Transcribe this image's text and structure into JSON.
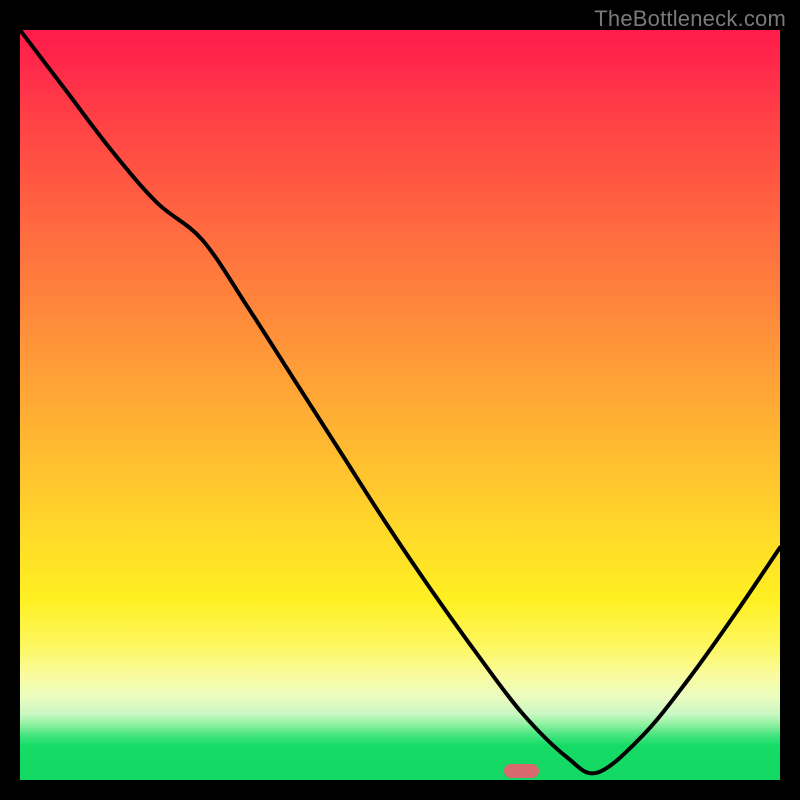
{
  "watermark": {
    "text": "TheBottleneck.com"
  },
  "chart_data": {
    "type": "line",
    "title": "",
    "xlabel": "",
    "ylabel": "",
    "x": [
      0,
      6,
      12,
      18,
      24,
      30,
      36,
      42,
      48,
      54,
      60,
      66,
      72,
      76,
      82,
      88,
      94,
      100
    ],
    "values": [
      100,
      92,
      84,
      77,
      72,
      63,
      53.5,
      44,
      34.5,
      25.5,
      17,
      9,
      3,
      1,
      6,
      13.5,
      22,
      31
    ],
    "xlim": [
      0,
      100
    ],
    "ylim": [
      0,
      100
    ],
    "bottleneck_x": 66,
    "bottleneck_width": 4
  },
  "colors": {
    "curve": "#000000",
    "marker": "#d86a6e",
    "background_black": "#000000"
  }
}
